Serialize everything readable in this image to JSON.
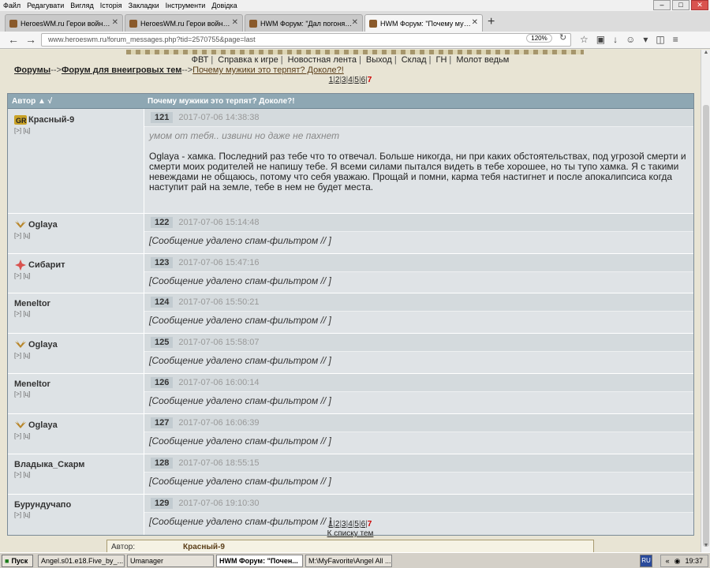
{
  "menu": [
    "Файл",
    "Редагувати",
    "Вигляд",
    "Історія",
    "Закладки",
    "Інструменти",
    "Довідка"
  ],
  "tabs": [
    {
      "title": "HeroesWM.ru Герои войны и..."
    },
    {
      "title": "HeroesWM.ru Герои войны и..."
    },
    {
      "title": "HWM Форум: \"Дал погонять..."
    },
    {
      "title": "HWM Форум: \"Почему мужик..."
    }
  ],
  "url": "www.heroeswm.ru/forum_messages.php?tid=2570755&page=last",
  "zoom": "120%",
  "topnav": [
    "ФВТ",
    "Справка к игре",
    "Новостная лента",
    "Выход",
    "Склад",
    "ГН",
    "Молот ведьм"
  ],
  "breadcrumb": {
    "forums": "Форумы",
    "arrow1": "-->",
    "section": "Форум для внеигровых тем",
    "arrow2": "-->",
    "topic": "Почему мужики это терпят? Доколе?!"
  },
  "pager": {
    "pages": [
      "1",
      "2",
      "3",
      "4",
      "5",
      "6"
    ],
    "current": "7"
  },
  "table": {
    "author_header": "Автор ▲ √",
    "topic_header": "Почему мужики это терпят? Доколе?!"
  },
  "posts": [
    {
      "author": "Красный-9",
      "links": "[>] [ц]",
      "num": "121",
      "date": "2017-07-06 14:38:38",
      "quote": "умом от тебя.. извини но даже не пахнет",
      "text": "Oglaya - хамка. Последний раз тебе что то отвечал. Больше никогда, ни при каких обстоятельствах, под угрозой смерти и смерти моих родителей не напишу тебе. Я всеми силами пытался видеть в тебе хорошее, но ты тупо хамка. Я с такими невеждами не общаюсь, потому что себя уважаю. Прощай и помни, карма тебя настигнет и после апокалипсиса когда наступит рай на земле, тебе в нем не будет места."
    },
    {
      "author": "Oglaya",
      "links": "[>] [ц]",
      "num": "122",
      "date": "2017-07-06 15:14:48",
      "text": "[Сообщение удалено спам-фильтром // ]"
    },
    {
      "author": "Сибарит",
      "links": "[>] [ц]",
      "num": "123",
      "date": "2017-07-06 15:47:16",
      "text": "[Сообщение удалено спам-фильтром // ]"
    },
    {
      "author": "Meneltor",
      "links": "[>] [ц]",
      "num": "124",
      "date": "2017-07-06 15:50:21",
      "text": "[Сообщение удалено спам-фильтром // ]"
    },
    {
      "author": "Oglaya",
      "links": "[>] [ц]",
      "num": "125",
      "date": "2017-07-06 15:58:07",
      "text": "[Сообщение удалено спам-фильтром // ]"
    },
    {
      "author": "Meneltor",
      "links": "[>] [ц]",
      "num": "126",
      "date": "2017-07-06 16:00:14",
      "text": "[Сообщение удалено спам-фильтром // ]"
    },
    {
      "author": "Oglaya",
      "links": "[>] [ц]",
      "num": "127",
      "date": "2017-07-06 16:06:39",
      "text": "[Сообщение удалено спам-фильтром // ]"
    },
    {
      "author": "Владыка_Скарм",
      "links": "[>] [ц]",
      "num": "128",
      "date": "2017-07-06 18:55:15",
      "text": "[Сообщение удалено спам-фильтром // ]"
    },
    {
      "author": "Бурундучапо",
      "links": "[>] [ц]",
      "num": "129",
      "date": "2017-07-06 19:10:30",
      "text": "[Сообщение удалено спам-фильтром // ]"
    }
  ],
  "back_link": "К списку тем",
  "reply_box": {
    "label": "Автор:",
    "value": "Красный-9"
  },
  "taskbar": {
    "start": "Пуск",
    "items": [
      "Angel.s01.e18.Five_by_...",
      "Umanager",
      "HWM Форум: \"Почен...",
      "M:\\MyFavorite\\Angel All ..."
    ],
    "lang": "RU",
    "clock": "19:37"
  }
}
